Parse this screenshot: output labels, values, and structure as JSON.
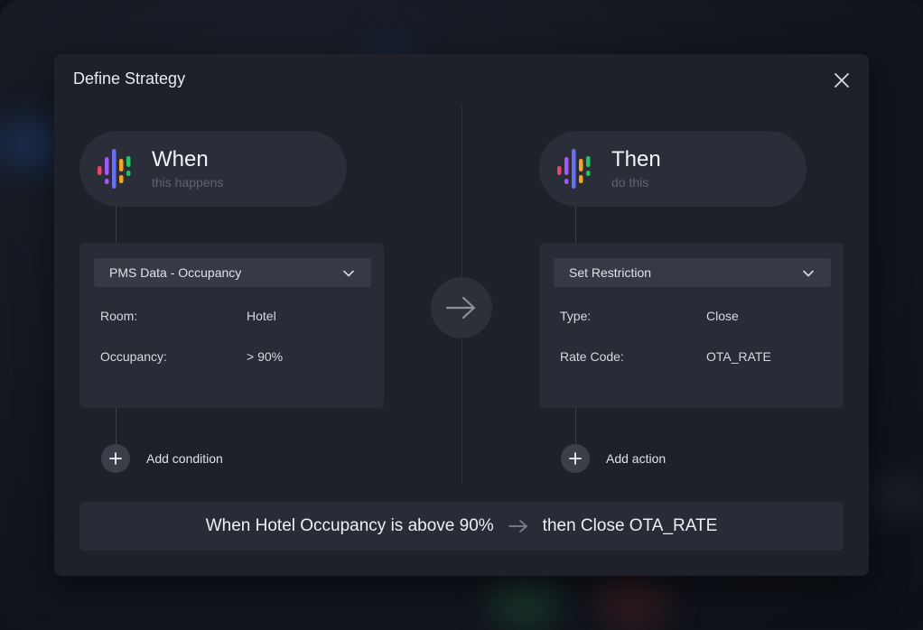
{
  "modal": {
    "title": "Define Strategy"
  },
  "icons": {
    "close": "close-icon",
    "logo": "equalizer-bars-logo-icon",
    "chevron": "chevron-down-icon",
    "plus": "plus-icon",
    "arrow": "arrow-right-icon"
  },
  "when": {
    "title": "When",
    "subtitle": "this happens",
    "select_value": "PMS Data - Occupancy",
    "rows": [
      {
        "label": "Room:",
        "value": "Hotel"
      },
      {
        "label": "Occupancy:",
        "value": "> 90%"
      }
    ],
    "add_label": "Add condition"
  },
  "then": {
    "title": "Then",
    "subtitle": "do this",
    "select_value": "Set Restriction",
    "rows": [
      {
        "label": "Type:",
        "value": "Close"
      },
      {
        "label": "Rate Code:",
        "value": "OTA_RATE"
      }
    ],
    "add_label": "Add action"
  },
  "summary": {
    "condition_text": "When Hotel Occupancy is above 90%",
    "action_text": "then Close OTA_RATE"
  },
  "colors": {
    "modal_bg": "#1e2129",
    "card_bg": "#282c36",
    "logo_bars": [
      "#e8456b",
      "#a855f7",
      "#6b6ff0",
      "#f5a524",
      "#22c55e"
    ]
  }
}
